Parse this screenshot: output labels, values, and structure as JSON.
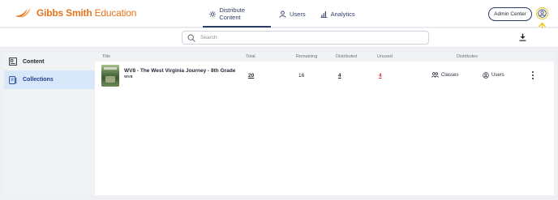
{
  "brand": {
    "name_bold": "Gibbs Smith",
    "name_light": "Education",
    "color": "#e8731c"
  },
  "nav": {
    "items": [
      {
        "label": "Distribute Content",
        "icon": "sun-icon",
        "active": true
      },
      {
        "label": "Users",
        "icon": "user-icon",
        "active": false
      },
      {
        "label": "Analytics",
        "icon": "bar-chart-icon",
        "active": false
      }
    ],
    "admin_label": "Admin Center",
    "account_icon": "account-circle-icon"
  },
  "search": {
    "placeholder": "Search",
    "value": ""
  },
  "sidebar": {
    "items": [
      {
        "label": "Content",
        "icon": "content-icon",
        "active": false
      },
      {
        "label": "Collections",
        "icon": "collections-icon",
        "active": true
      }
    ]
  },
  "table": {
    "headers": {
      "title": "Title",
      "total": "Total",
      "remaining": "Remaining",
      "distributed": "Distributed",
      "unused": "Unused",
      "distributes": "Distributes"
    },
    "rows": [
      {
        "title": "WV8 - The West Virginia Journey - 8th Grade",
        "code": "WV8",
        "total": "20",
        "remaining": "16",
        "distributed": "4",
        "unused": "4",
        "classes_label": "Classes",
        "users_label": "Users"
      }
    ]
  },
  "colors": {
    "accent": "#2c3a66",
    "sidebar_active": "#d8e7f9",
    "unused_red": "#d93025",
    "highlight_yellow": "#f0c514"
  }
}
